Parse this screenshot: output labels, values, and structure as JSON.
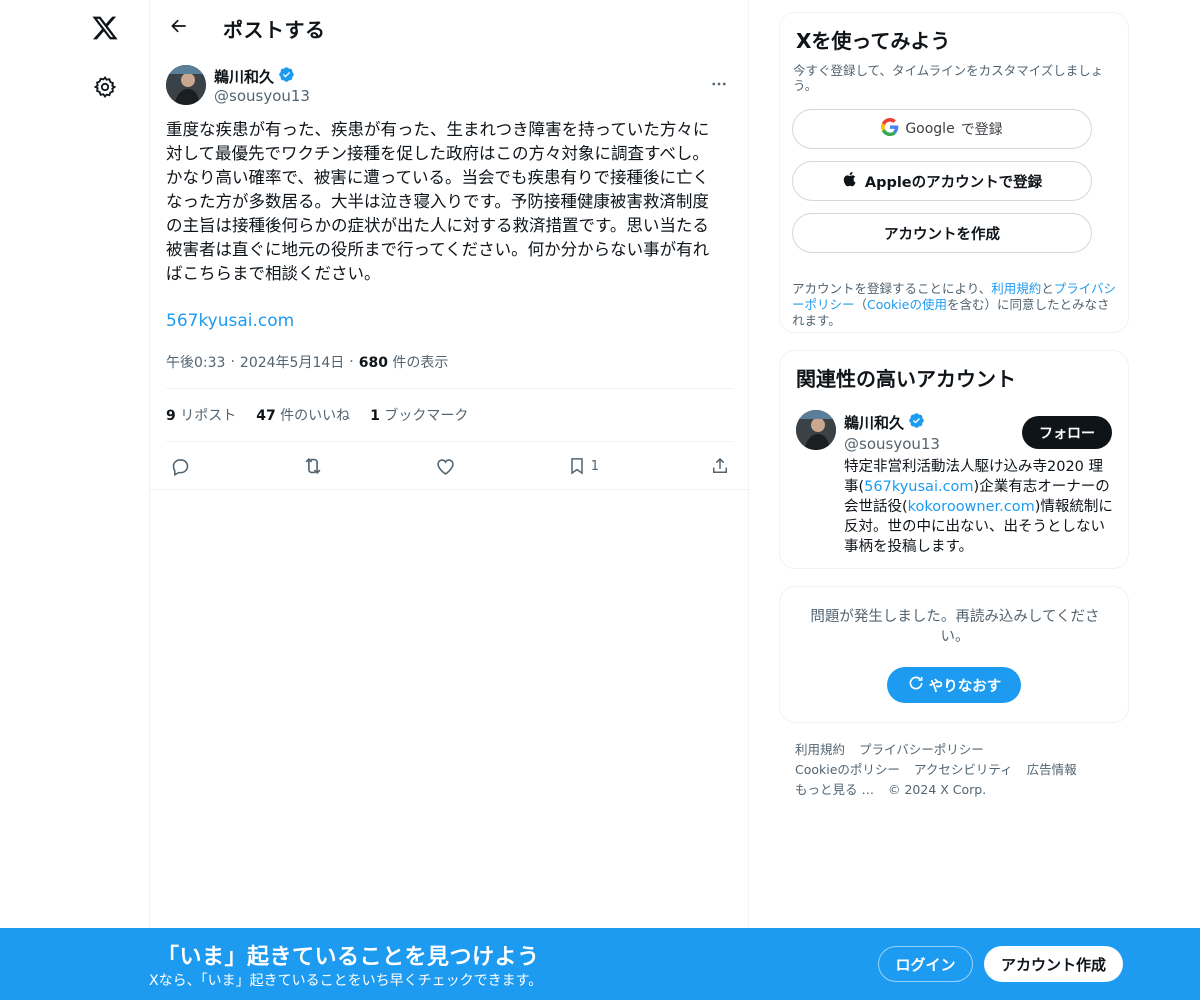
{
  "colors": {
    "accent": "#1d9bf0",
    "text": "#0f1419",
    "muted": "#536471",
    "border": "#eff3f4",
    "verified": "#1d9bf0"
  },
  "nav": {
    "logo_icon": "x-logo-icon",
    "settings_icon": "gear-icon"
  },
  "header": {
    "title": "ポストする",
    "back_icon": "back-arrow-icon"
  },
  "post": {
    "author_name": "鵜川和久",
    "author_handle": "@sousyou13",
    "text": "重度な疾患が有った、疾患が有った、生まれつき障害を持っていた方々に\n対して最優先でワクチン接種を促した政府はこの方々対象に調査すべし。\nかなり高い確率で、被害に遭っている。当会でも疾患有りで接種後に亡く\nなった方が多数居る。大半は泣き寝入りです。予防接種健康被害救済制度\nの主旨は接種後何らかの症状が出た人に対する救済措置です。思い当たる\n被害者は直ぐに地元の役所まで行ってください。何か分からない事が有れ\nばこちらまで相談ください。",
    "link": "567kyusai.com",
    "time": "午後0:33",
    "sep": "·",
    "date": "2024年5月14日",
    "views_count": "680",
    "views_label": "件の表示",
    "reposts_count": "9",
    "reposts_label": "リポスト",
    "likes_count": "47",
    "likes_label": "件のいいね",
    "bookmarks_count": "1",
    "bookmarks_label": "ブックマーク",
    "bookmark_action_count": "1"
  },
  "signup": {
    "title": "Xを使ってみよう",
    "subtitle": "今すぐ登録して、タイムラインをカスタマイズしましょう。",
    "google_label_brand": "Google",
    "google_label_rest": "で登録",
    "apple_label": "Appleのアカウントで登録",
    "create_label": "アカウントを作成",
    "legal_1": "アカウントを登録することにより、",
    "legal_terms": "利用規約",
    "legal_and": "と",
    "legal_privacy": "プライバシーポリシー",
    "legal_2": "（",
    "legal_cookie": "Cookieの使用",
    "legal_3": "を含む）に同意したとみなされます。"
  },
  "related": {
    "title": "関連性の高いアカウント",
    "name": "鵜川和久",
    "handle": "@sousyou13",
    "follow_label": "フォロー",
    "bio_1": "特定非営利活動法人駆け込み寺2020 理事(",
    "bio_link1": "567kyusai.com",
    "bio_2": ")企業有志オーナーの会世話役(",
    "bio_link2": "kokoroowner.com",
    "bio_3": ")情報統制に反対。世の中に出ない、出そうとしない事柄を投稿します。"
  },
  "error": {
    "text": "問題が発生しました。再読み込みしてください。",
    "retry_label": "やりなおす"
  },
  "footer": {
    "terms": "利用規約",
    "privacy": "プライバシーポリシー",
    "cookie": "Cookieのポリシー",
    "accessibility": "アクセシビリティ",
    "ads": "広告情報",
    "more": "もっと見る …",
    "copyright": "© 2024 X Corp."
  },
  "banner": {
    "title": "「いま」起きていることを見つけよう",
    "subtitle": "Xなら、「いま」起きていることをいち早くチェックできます。",
    "login_label": "ログイン",
    "signup_label": "アカウント作成"
  }
}
